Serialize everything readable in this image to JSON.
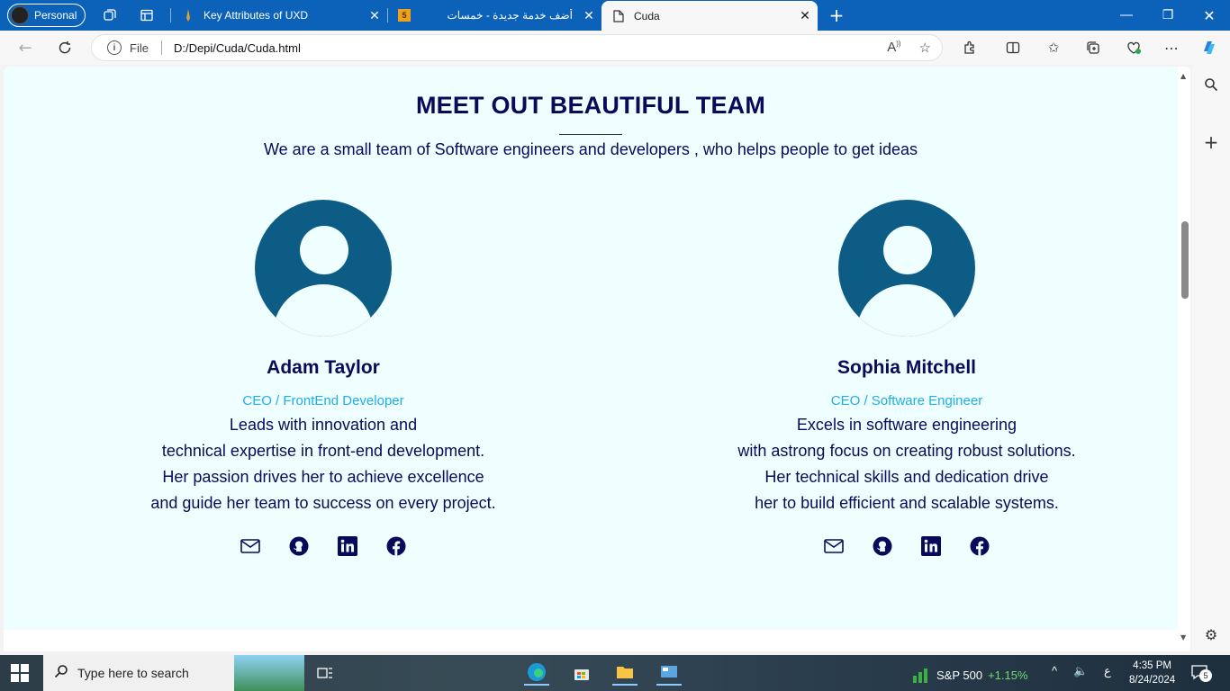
{
  "browser": {
    "profile_label": "Personal",
    "tabs": [
      {
        "title": "Key Attributes of UXD",
        "favicon": "pencil-icon"
      },
      {
        "title": "أضف خدمة جديدة - خمسات",
        "favicon": "5"
      },
      {
        "title": "Cuda",
        "favicon": "page-icon"
      }
    ],
    "address": {
      "scheme_label": "File",
      "url": "D:/Depi/Cuda/Cuda.html"
    }
  },
  "page": {
    "heading": "MEET OUT BEAUTIFUL TEAM",
    "subheading": "We are a small team of Software engineers and developers , who helps people to get ideas",
    "members": [
      {
        "name": "Adam Taylor",
        "role": "CEO / FrontEnd Developer",
        "bio": [
          "Leads with innovation and",
          "technical expertise in front-end development.",
          "Her passion drives her to achieve excellence",
          "and guide her team to success on every project."
        ]
      },
      {
        "name": "Sophia Mitchell",
        "role": "CEO / Software Engineer",
        "bio": [
          "Excels in software engineering",
          "with astrong focus on creating robust solutions.",
          "Her technical skills and dedication drive",
          "her to build efficient and scalable systems."
        ]
      }
    ]
  },
  "taskbar": {
    "search_placeholder": "Type here to search",
    "ticker_name": "S&P 500",
    "ticker_change": "+1.15%",
    "lang": "ع",
    "time": "4:35 PM",
    "date": "8/24/2024",
    "notif_count": "5"
  },
  "colors": {
    "accent": "#0b62b8",
    "team_heading": "#0a0a5a",
    "role": "#21aee6",
    "avatar": "#0d5c85",
    "page_bg": "#effefe"
  }
}
